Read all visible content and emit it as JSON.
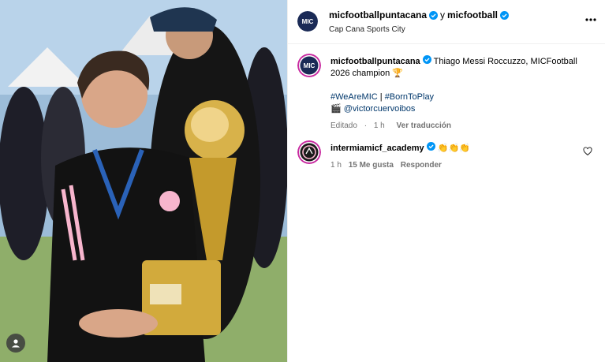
{
  "header": {
    "username": "micfootballpuntacana",
    "connector": "y",
    "collaborator": "micfootball",
    "location": "Cap Cana Sports City",
    "more_icon": "more-horizontal-icon"
  },
  "post": {
    "username": "micfootballpuntacana",
    "caption_line1": "Thiago Messi Roccuzzo, MICFootball",
    "caption_line2": "2026 champion",
    "trophy_emoji": "🏆",
    "hashtag1": "#WeAreMIC",
    "separator": "|",
    "hashtag2": "#BornToPlay",
    "camera_emoji": "🎬",
    "mention": "@victorcuervoibos",
    "edited_label": "Editado",
    "dot": "·",
    "time": "1 h",
    "see_translation": "Ver traducción"
  },
  "comment": {
    "username": "intermiamicf_academy",
    "emojis": "👏👏👏",
    "time": "1 h",
    "likes": "15 Me gusta",
    "reply": "Responder"
  },
  "colors": {
    "verified": "#0095f6",
    "link": "#00376b",
    "meta": "#737373",
    "inter_pink": "#f7b5cd"
  }
}
